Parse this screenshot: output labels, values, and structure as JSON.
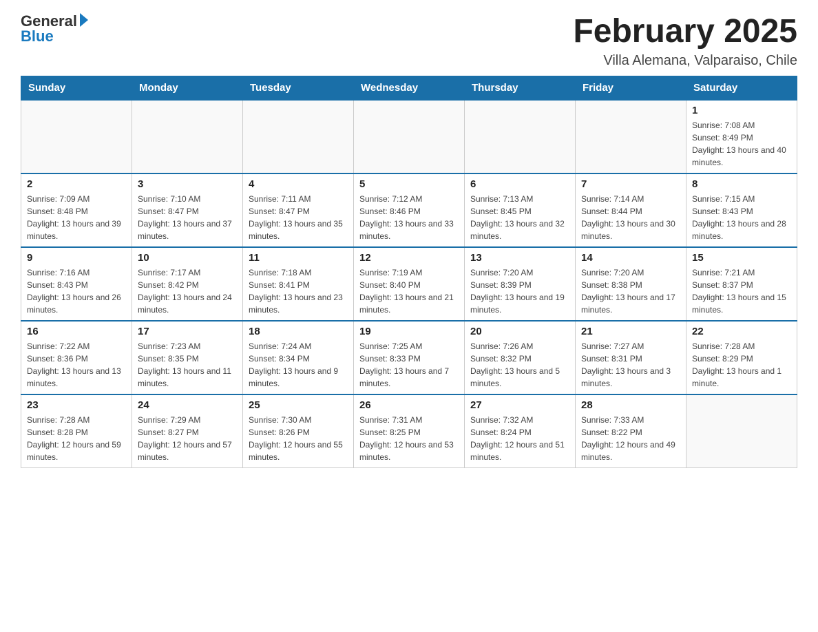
{
  "header": {
    "logo_general": "General",
    "logo_blue": "Blue",
    "month_title": "February 2025",
    "location": "Villa Alemana, Valparaiso, Chile"
  },
  "weekdays": [
    "Sunday",
    "Monday",
    "Tuesday",
    "Wednesday",
    "Thursday",
    "Friday",
    "Saturday"
  ],
  "weeks": [
    [
      {
        "day": "",
        "sunrise": "",
        "sunset": "",
        "daylight": ""
      },
      {
        "day": "",
        "sunrise": "",
        "sunset": "",
        "daylight": ""
      },
      {
        "day": "",
        "sunrise": "",
        "sunset": "",
        "daylight": ""
      },
      {
        "day": "",
        "sunrise": "",
        "sunset": "",
        "daylight": ""
      },
      {
        "day": "",
        "sunrise": "",
        "sunset": "",
        "daylight": ""
      },
      {
        "day": "",
        "sunrise": "",
        "sunset": "",
        "daylight": ""
      },
      {
        "day": "1",
        "sunrise": "Sunrise: 7:08 AM",
        "sunset": "Sunset: 8:49 PM",
        "daylight": "Daylight: 13 hours and 40 minutes."
      }
    ],
    [
      {
        "day": "2",
        "sunrise": "Sunrise: 7:09 AM",
        "sunset": "Sunset: 8:48 PM",
        "daylight": "Daylight: 13 hours and 39 minutes."
      },
      {
        "day": "3",
        "sunrise": "Sunrise: 7:10 AM",
        "sunset": "Sunset: 8:47 PM",
        "daylight": "Daylight: 13 hours and 37 minutes."
      },
      {
        "day": "4",
        "sunrise": "Sunrise: 7:11 AM",
        "sunset": "Sunset: 8:47 PM",
        "daylight": "Daylight: 13 hours and 35 minutes."
      },
      {
        "day": "5",
        "sunrise": "Sunrise: 7:12 AM",
        "sunset": "Sunset: 8:46 PM",
        "daylight": "Daylight: 13 hours and 33 minutes."
      },
      {
        "day": "6",
        "sunrise": "Sunrise: 7:13 AM",
        "sunset": "Sunset: 8:45 PM",
        "daylight": "Daylight: 13 hours and 32 minutes."
      },
      {
        "day": "7",
        "sunrise": "Sunrise: 7:14 AM",
        "sunset": "Sunset: 8:44 PM",
        "daylight": "Daylight: 13 hours and 30 minutes."
      },
      {
        "day": "8",
        "sunrise": "Sunrise: 7:15 AM",
        "sunset": "Sunset: 8:43 PM",
        "daylight": "Daylight: 13 hours and 28 minutes."
      }
    ],
    [
      {
        "day": "9",
        "sunrise": "Sunrise: 7:16 AM",
        "sunset": "Sunset: 8:43 PM",
        "daylight": "Daylight: 13 hours and 26 minutes."
      },
      {
        "day": "10",
        "sunrise": "Sunrise: 7:17 AM",
        "sunset": "Sunset: 8:42 PM",
        "daylight": "Daylight: 13 hours and 24 minutes."
      },
      {
        "day": "11",
        "sunrise": "Sunrise: 7:18 AM",
        "sunset": "Sunset: 8:41 PM",
        "daylight": "Daylight: 13 hours and 23 minutes."
      },
      {
        "day": "12",
        "sunrise": "Sunrise: 7:19 AM",
        "sunset": "Sunset: 8:40 PM",
        "daylight": "Daylight: 13 hours and 21 minutes."
      },
      {
        "day": "13",
        "sunrise": "Sunrise: 7:20 AM",
        "sunset": "Sunset: 8:39 PM",
        "daylight": "Daylight: 13 hours and 19 minutes."
      },
      {
        "day": "14",
        "sunrise": "Sunrise: 7:20 AM",
        "sunset": "Sunset: 8:38 PM",
        "daylight": "Daylight: 13 hours and 17 minutes."
      },
      {
        "day": "15",
        "sunrise": "Sunrise: 7:21 AM",
        "sunset": "Sunset: 8:37 PM",
        "daylight": "Daylight: 13 hours and 15 minutes."
      }
    ],
    [
      {
        "day": "16",
        "sunrise": "Sunrise: 7:22 AM",
        "sunset": "Sunset: 8:36 PM",
        "daylight": "Daylight: 13 hours and 13 minutes."
      },
      {
        "day": "17",
        "sunrise": "Sunrise: 7:23 AM",
        "sunset": "Sunset: 8:35 PM",
        "daylight": "Daylight: 13 hours and 11 minutes."
      },
      {
        "day": "18",
        "sunrise": "Sunrise: 7:24 AM",
        "sunset": "Sunset: 8:34 PM",
        "daylight": "Daylight: 13 hours and 9 minutes."
      },
      {
        "day": "19",
        "sunrise": "Sunrise: 7:25 AM",
        "sunset": "Sunset: 8:33 PM",
        "daylight": "Daylight: 13 hours and 7 minutes."
      },
      {
        "day": "20",
        "sunrise": "Sunrise: 7:26 AM",
        "sunset": "Sunset: 8:32 PM",
        "daylight": "Daylight: 13 hours and 5 minutes."
      },
      {
        "day": "21",
        "sunrise": "Sunrise: 7:27 AM",
        "sunset": "Sunset: 8:31 PM",
        "daylight": "Daylight: 13 hours and 3 minutes."
      },
      {
        "day": "22",
        "sunrise": "Sunrise: 7:28 AM",
        "sunset": "Sunset: 8:29 PM",
        "daylight": "Daylight: 13 hours and 1 minute."
      }
    ],
    [
      {
        "day": "23",
        "sunrise": "Sunrise: 7:28 AM",
        "sunset": "Sunset: 8:28 PM",
        "daylight": "Daylight: 12 hours and 59 minutes."
      },
      {
        "day": "24",
        "sunrise": "Sunrise: 7:29 AM",
        "sunset": "Sunset: 8:27 PM",
        "daylight": "Daylight: 12 hours and 57 minutes."
      },
      {
        "day": "25",
        "sunrise": "Sunrise: 7:30 AM",
        "sunset": "Sunset: 8:26 PM",
        "daylight": "Daylight: 12 hours and 55 minutes."
      },
      {
        "day": "26",
        "sunrise": "Sunrise: 7:31 AM",
        "sunset": "Sunset: 8:25 PM",
        "daylight": "Daylight: 12 hours and 53 minutes."
      },
      {
        "day": "27",
        "sunrise": "Sunrise: 7:32 AM",
        "sunset": "Sunset: 8:24 PM",
        "daylight": "Daylight: 12 hours and 51 minutes."
      },
      {
        "day": "28",
        "sunrise": "Sunrise: 7:33 AM",
        "sunset": "Sunset: 8:22 PM",
        "daylight": "Daylight: 12 hours and 49 minutes."
      },
      {
        "day": "",
        "sunrise": "",
        "sunset": "",
        "daylight": ""
      }
    ]
  ]
}
